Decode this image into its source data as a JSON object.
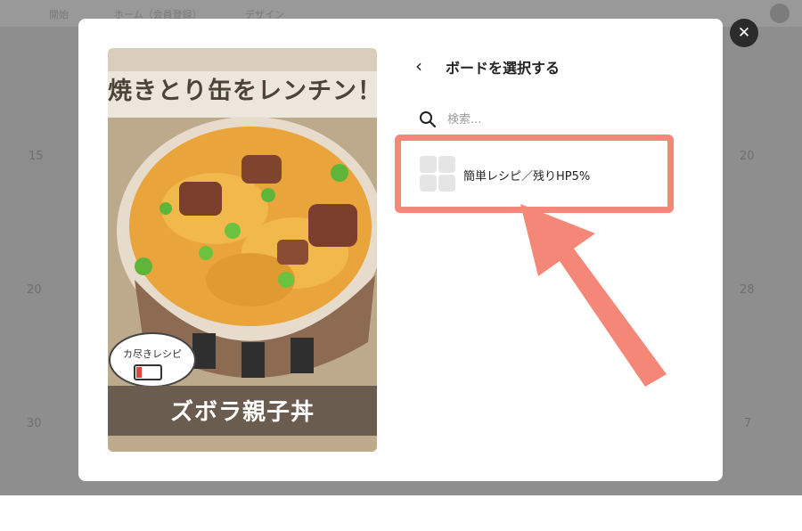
{
  "background": {
    "nav_items": [
      "開始",
      "ホーム（会員登録）",
      "デザイン"
    ],
    "left_numbers": [
      "15",
      "20",
      "30"
    ],
    "right_numbers": [
      "20",
      "28",
      "7"
    ]
  },
  "modal": {
    "close_label": "✕",
    "back_label": "‹",
    "title": "ボードを選択する",
    "search": {
      "placeholder": "検索..."
    },
    "boards": [
      {
        "name": "簡単レシピ／残りHP5%"
      }
    ]
  },
  "pin": {
    "title": "焼きとり缶をレンチン！",
    "bubble": "カ尽きレシピ",
    "banner": "ズボラ親子丼"
  },
  "colors": {
    "overlay": "#8e8e8e",
    "highlight": "#f58778",
    "close_button": "#2b2b2b",
    "banner": "#6b5c50"
  }
}
